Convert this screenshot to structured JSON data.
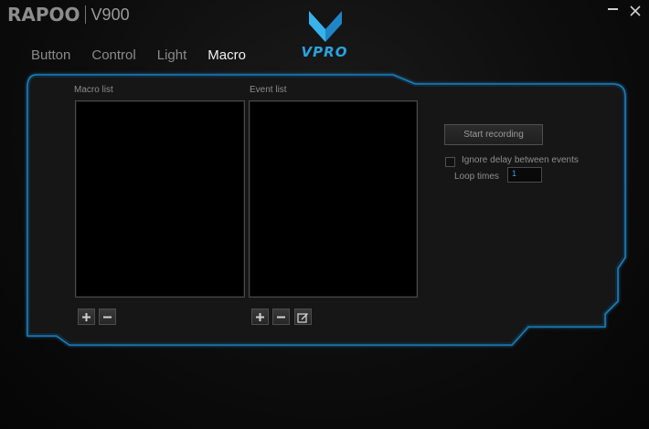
{
  "app": {
    "brand": "RAPOO",
    "model": "V900"
  },
  "window": {
    "minimize_icon": "minimize-icon",
    "close_label": "✕"
  },
  "tabs": [
    {
      "label": "Button",
      "active": false
    },
    {
      "label": "Control",
      "active": false
    },
    {
      "label": "Light",
      "active": false
    },
    {
      "label": "Macro",
      "active": true
    }
  ],
  "logo": {
    "text": "VPRO",
    "icon": "vpro-chevron-icon"
  },
  "macro_list": {
    "label": "Macro list",
    "add_icon": "plus-icon",
    "remove_icon": "minus-icon"
  },
  "event_list": {
    "label": "Event list",
    "add_icon": "plus-icon",
    "remove_icon": "minus-icon",
    "edit_icon": "edit-icon"
  },
  "recording": {
    "start_label": "Start recording",
    "ignore_delay_label": "Ignore delay between events",
    "ignore_delay_checked": false,
    "loop_times_label": "Loop times",
    "loop_times_value": "1"
  },
  "colors": {
    "accent": "#2aa3dc",
    "frame": "#1e7fb8",
    "background": "#0d0d0d"
  }
}
